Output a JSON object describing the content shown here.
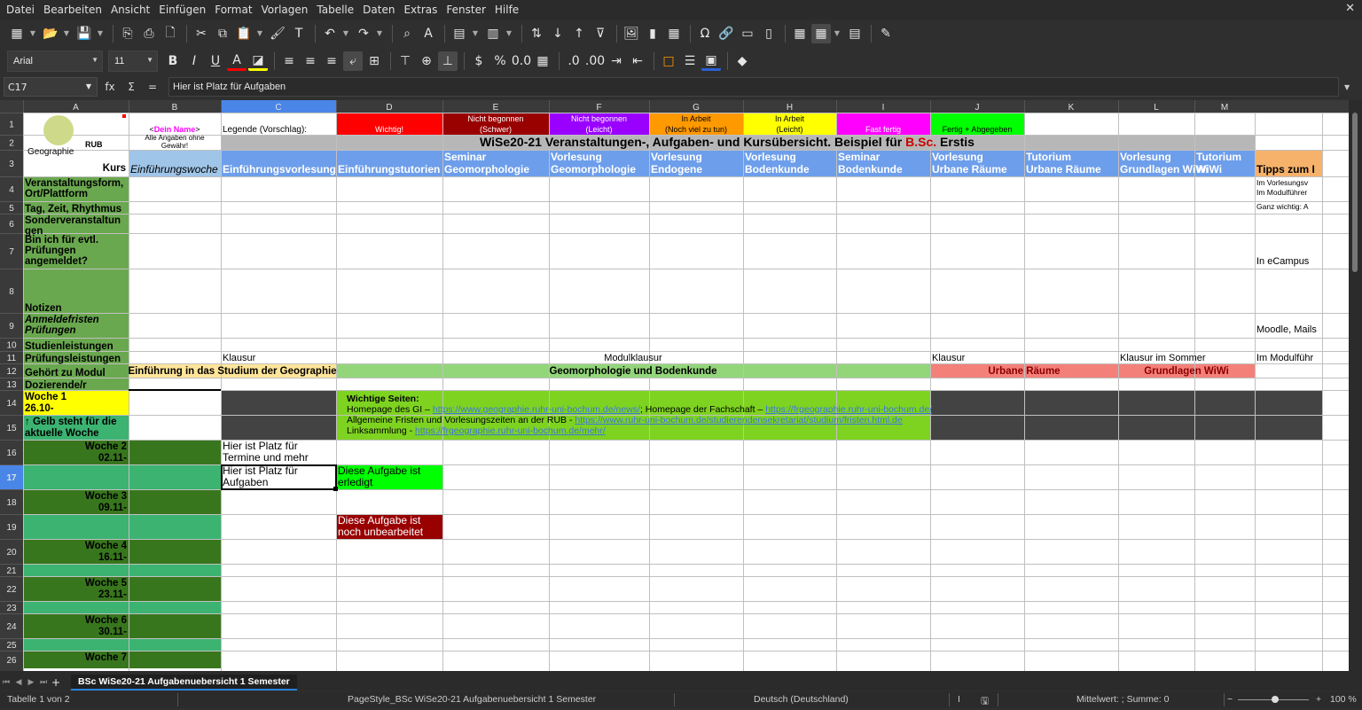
{
  "menu": [
    "Datei",
    "Bearbeiten",
    "Ansicht",
    "Einfügen",
    "Format",
    "Vorlagen",
    "Tabelle",
    "Daten",
    "Extras",
    "Fenster",
    "Hilfe"
  ],
  "font": {
    "name": "Arial",
    "size": "11"
  },
  "formula": {
    "cell": "C17",
    "content": "Hier ist Platz für Aufgaben"
  },
  "columns": [
    "A",
    "B",
    "C",
    "D",
    "E",
    "F",
    "G",
    "H",
    "I",
    "J",
    "K",
    "L",
    "M"
  ],
  "rows": [
    "1",
    "2",
    "3",
    "4",
    "5",
    "6",
    "7",
    "8",
    "9",
    "10",
    "11",
    "12",
    "13",
    "14",
    "15",
    "16",
    "17",
    "18",
    "19",
    "20",
    "21",
    "22",
    "23",
    "24",
    "25",
    "26"
  ],
  "legend": {
    "name_prefix": "<",
    "name": "Dein Name",
    "name_suffix": ">",
    "disclaimer1": "Alle Angaben ohne",
    "disclaimer2": "Gewähr!",
    "label": "Legende (Vorschlag):",
    "items": [
      {
        "l1": "",
        "l2": "Wichtig!",
        "bg": "#ff0000",
        "fg": "#ffffff"
      },
      {
        "l1": "Nicht begonnen",
        "l2": "(Schwer)",
        "bg": "#990000",
        "fg": "#ffffff"
      },
      {
        "l1": "Nicht begonnen",
        "l2": "(Leicht)",
        "bg": "#9900ff",
        "fg": "#ffffff"
      },
      {
        "l1": "In Arbeit",
        "l2": "(Noch viel zu tun)",
        "bg": "#ff9900",
        "fg": "#000000"
      },
      {
        "l1": "In Arbeit",
        "l2": "(Leicht)",
        "bg": "#ffff00",
        "fg": "#000000"
      },
      {
        "l1": "",
        "l2": "Fast fertig",
        "bg": "#ff00ff",
        "fg": "#ffffff"
      },
      {
        "l1": "",
        "l2": "Fertig + Abgegeben",
        "bg": "#00ff00",
        "fg": "#000000"
      }
    ]
  },
  "logo": {
    "rub": "RUB",
    "geo": "Geographie"
  },
  "title": {
    "main": "WiSe20-21 Veranstaltungen-, Aufgaben- und Kursübersicht. Beispiel für ",
    "highlight": "B.Sc.",
    "tail": " Erstis"
  },
  "kurs_label": "Kurs",
  "course_headers": [
    {
      "l1": "",
      "l2": "Einführungswoche",
      "italic": true
    },
    {
      "l1": "",
      "l2": "Einführungsvorlesung"
    },
    {
      "l1": "",
      "l2": "Einführungstutorien"
    },
    {
      "l1": "Seminar",
      "l2": "Geomorphologie"
    },
    {
      "l1": "Vorlesung",
      "l2": "Geomorphologie"
    },
    {
      "l1": "Vorlesung",
      "l2": "Endogene"
    },
    {
      "l1": "Vorlesung",
      "l2": "Bodenkunde"
    },
    {
      "l1": "Seminar",
      "l2": "Bodenkunde"
    },
    {
      "l1": "Vorlesung",
      "l2": "Urbane Räume"
    },
    {
      "l1": "Tutorium",
      "l2": "Urbane Räume"
    },
    {
      "l1": "Vorlesung",
      "l2": "Grundlagen WiWi"
    },
    {
      "l1": "Tutorium",
      "l2": "WiWi"
    }
  ],
  "tips_header": "Tipps zum I",
  "row_labels": [
    {
      "row": 4,
      "text": "Veranstaltungsform, Ort/Plattform"
    },
    {
      "row": 5,
      "text": "Tag, Zeit, Rhythmus"
    },
    {
      "row": 6,
      "text": "Sonderveranstaltun gen"
    },
    {
      "row": 7,
      "text": "Bin ich für evtl. Prüfungen angemeldet?"
    },
    {
      "row": 8,
      "text": "Notizen"
    },
    {
      "row": 9,
      "text": "Anmeldefristen Prüfungen",
      "italic": true
    },
    {
      "row": 10,
      "text": "Studienleistungen"
    },
    {
      "row": 11,
      "text": "Prüfungsleistungen"
    },
    {
      "row": 12,
      "text": "Gehört zu Modul"
    },
    {
      "row": 13,
      "text": "Dozierende/r"
    }
  ],
  "tips": [
    "Im Vorlesungsv",
    "Im Modulführer",
    "Ganz wichtig: A",
    "In eCampus",
    "Moodle, Mails",
    "Im Modulführ"
  ],
  "exams": {
    "c": "Klausur",
    "mid": "Modulklausur",
    "j": "Klausur",
    "l": "Klausur im Sommer"
  },
  "modules": [
    {
      "text": "Einführung in das Studium der Geographie",
      "bg": "#ffe599"
    },
    {
      "text": "Geomorphologie und Bodenkunde",
      "bg": "#93d67a"
    },
    {
      "text": "Urbane Räume",
      "bg": "#f4807a"
    },
    {
      "text": "Grundlagen WiWi",
      "bg": "#f4807a"
    }
  ],
  "weeks": [
    {
      "l1": "Woche 1",
      "l2": "26.10-"
    },
    {
      "l1": "Woche 2",
      "l2": "02.11-"
    },
    {
      "l1": "Woche 3",
      "l2": "09.11-"
    },
    {
      "l1": "Woche 4",
      "l2": "16.11-"
    },
    {
      "l1": "Woche 5",
      "l2": "23.11-"
    },
    {
      "l1": "Woche 6",
      "l2": "30.11-"
    },
    {
      "l1": "Woche 7",
      "l2": ""
    }
  ],
  "yellow_note": "↑ Gelb steht für die aktuelle Woche",
  "important": {
    "title": "Wichtige Seiten:",
    "l1a": "Homepage des GI – ",
    "l1b": "https://www.geographie.ruhr-uni-bochum.de/news/",
    "l1c": "; Homepage der Fachschaft – ",
    "l1d": "https://frgeographie.ruhr-uni-bochum.de/",
    "l2a": "Allgemeine Fristen und Vorlesungszeiten an der RUB - ",
    "l2b": "https://www.ruhr-uni-bochum.de/studierendensekretariat/studium/fristen.html.de",
    "l3a": "Linksammlung - ",
    "l3b": "https://frgeographie.ruhr-uni-bochum.de/mehr/"
  },
  "notes": {
    "termine1": "Hier ist Platz für",
    "termine2": "Termine und mehr",
    "aufgaben1": "Hier ist Platz für",
    "aufgaben2": "Aufgaben",
    "done1": "Diese Aufgabe ist",
    "done2": "erledigt",
    "todo1": "Diese Aufgabe ist",
    "todo2": "noch unbearbeitet"
  },
  "colors": {
    "header_blue": "#6d9eeb",
    "row_green": "#6aa84f",
    "week_dark": "#38761d",
    "week_light": "#3cb371",
    "selected_col": "#4a86e8",
    "grey_band": "#b7b7b7",
    "dark_fill": "#434343",
    "link": "#3c78d8"
  },
  "sheet_tab": "BSc WiSe20-21 Aufgabenuebersicht 1 Semester",
  "status": {
    "page": "Tabelle 1 von 2",
    "style": "PageStyle_BSc WiSe20-21 Aufgabenuebersicht 1 Semester",
    "lang": "Deutsch (Deutschland)",
    "sum": "Mittelwert: ; Summe: 0",
    "zoom": "100 %"
  },
  "icons": [
    "spreadsheet-icon",
    "open-icon",
    "save-icon",
    "export-pdf-icon",
    "print-icon",
    "print-preview-icon",
    "cut-icon",
    "copy-icon",
    "paste-icon",
    "clone-formatting-icon",
    "clear-formatting-icon",
    "undo-icon",
    "redo-icon",
    "find-icon",
    "spelling-icon",
    "row-icon",
    "column-icon",
    "sort-icon",
    "sort-asc-icon",
    "sort-desc-icon",
    "autofilter-icon",
    "image-icon",
    "chart-icon",
    "pivot-icon",
    "special-char-icon",
    "hyperlink-icon",
    "comment-icon",
    "headers-footers-icon",
    "define-print-area-icon",
    "freeze-icon",
    "split-icon",
    "show-draw-icon"
  ]
}
